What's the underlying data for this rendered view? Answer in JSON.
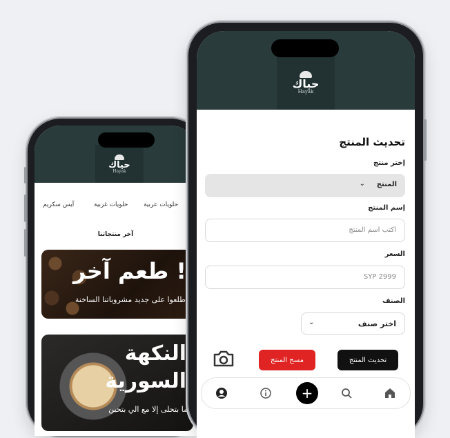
{
  "colors": {
    "header": "#2a3b3b",
    "accent_red": "#e02424",
    "dark": "#111111"
  },
  "logo": {
    "main": "حياك",
    "sub": "Hayak"
  },
  "back_screen": {
    "categories": [
      "حلويات عربية",
      "حلويات غربية",
      "آيس سكريم"
    ],
    "latest_label": "آخر منتجاتنا",
    "banner1": {
      "title": "طعم آخر !",
      "subtitle": "اطلعوا على جديد مشروباتنا الساخنة"
    },
    "banner2": {
      "title_line1": "النكهة",
      "title_line2": "السورية",
      "subtitle": "ما بتحلى إلا مع الي بتحبن"
    }
  },
  "form": {
    "title": "تحديث المنتج",
    "select_product_label": "إختر منتج",
    "select_product_value": "المنتج",
    "name_label": "إسم المنتج",
    "name_placeholder": "اكتب اسم المنتج",
    "price_label": "السعر",
    "price_placeholder": "SYP 2999",
    "category_label": "الصنف",
    "category_value": "اختر صنف",
    "update_button": "تحديث المنتج",
    "clear_button": "مسح المنتج"
  },
  "nav_icons": [
    "home-icon",
    "search-icon",
    "add-icon",
    "info-icon",
    "profile-icon"
  ]
}
